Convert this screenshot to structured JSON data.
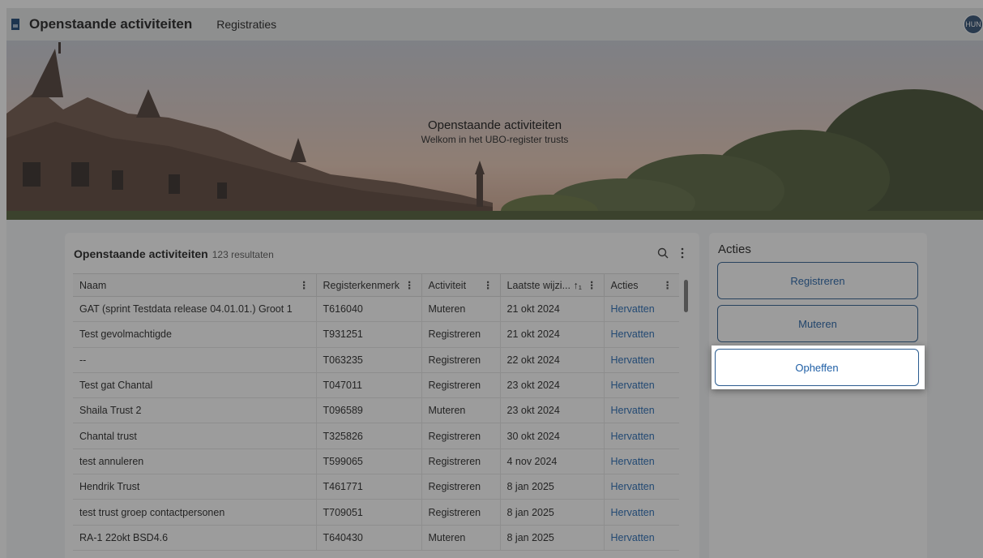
{
  "header": {
    "app_title": "Openstaande activiteiten",
    "nav": [
      "Registraties"
    ],
    "avatar_initials": "HUN"
  },
  "hero": {
    "title": "Openstaande activiteiten",
    "subtitle": "Welkom in het UBO-register trusts"
  },
  "table_card": {
    "title": "Openstaande activiteiten",
    "count": "123 resultaten",
    "columns": [
      "Naam",
      "Registerkenmerk",
      "Activiteit",
      "Laatste wijzi... ↑₁",
      "Acties"
    ],
    "rows": [
      [
        "GAT (sprint Testdata release 04.01.01.) Groot 1",
        "T616040",
        "Muteren",
        "21 okt 2024",
        "Hervatten"
      ],
      [
        "Test gevolmachtigde",
        "T931251",
        "Registreren",
        "21 okt 2024",
        "Hervatten"
      ],
      [
        "--",
        "T063235",
        "Registreren",
        "22 okt 2024",
        "Hervatten"
      ],
      [
        "Test gat Chantal",
        "T047011",
        "Registreren",
        "23 okt 2024",
        "Hervatten"
      ],
      [
        "Shaila Trust 2",
        "T096589",
        "Muteren",
        "23 okt 2024",
        "Hervatten"
      ],
      [
        "Chantal trust",
        "T325826",
        "Registreren",
        "30 okt 2024",
        "Hervatten"
      ],
      [
        "test annuleren",
        "T599065",
        "Registreren",
        "4 nov 2024",
        "Hervatten"
      ],
      [
        "Hendrik Trust",
        "T461771",
        "Registreren",
        "8 jan 2025",
        "Hervatten"
      ],
      [
        "test trust groep contactpersonen",
        "T709051",
        "Registreren",
        "8 jan 2025",
        "Hervatten"
      ],
      [
        "RA-1 22okt BSD4.6",
        "T640430",
        "Muteren",
        "8 jan 2025",
        "Hervatten"
      ]
    ]
  },
  "actions_card": {
    "title": "Acties",
    "buttons": [
      "Registreren",
      "Muteren",
      "Opheffen"
    ]
  },
  "icons": {
    "search": "search-icon",
    "more": "more-vertical-icon"
  },
  "colors": {
    "link": "#1f66b3",
    "accent": "#154273"
  }
}
